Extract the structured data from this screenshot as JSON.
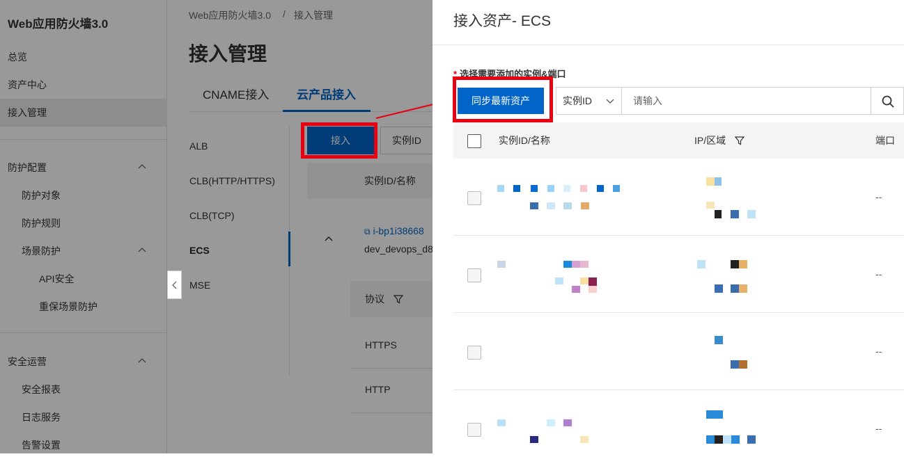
{
  "sidebar": {
    "app_title": "Web应用防火墙3.0",
    "items": [
      {
        "label": "总览"
      },
      {
        "label": "资产中心"
      },
      {
        "label": "接入管理",
        "active": true
      },
      {
        "label": "防护配置",
        "expandable": true
      },
      {
        "label": "防护对象"
      },
      {
        "label": "防护规则"
      },
      {
        "label": "场景防护",
        "expandable": true
      },
      {
        "label": "API安全"
      },
      {
        "label": "重保场景防护"
      },
      {
        "label": "安全运营",
        "expandable": true
      },
      {
        "label": "安全报表"
      },
      {
        "label": "日志服务"
      },
      {
        "label": "告警设置"
      }
    ]
  },
  "breadcrumb": {
    "root": "Web应用防火墙3.0",
    "separator": "/",
    "current": "接入管理"
  },
  "page": {
    "title": "接入管理",
    "tabs": [
      {
        "label": "CNAME接入"
      },
      {
        "label": "云产品接入",
        "active": true
      }
    ],
    "products": [
      {
        "label": "ALB"
      },
      {
        "label": "CLB(HTTP/HTTPS)"
      },
      {
        "label": "CLB(TCP)"
      },
      {
        "label": "ECS",
        "active": true
      },
      {
        "label": "MSE"
      }
    ],
    "join_button": "接入",
    "id_select": "实例ID",
    "table_header": "实例ID/名称",
    "instance_link": "i-bp1i38668",
    "instance_name": "dev_devops_d8",
    "sub_table_header": "协议",
    "protocols": [
      "HTTPS",
      "HTTP"
    ]
  },
  "drawer": {
    "title": "接入资产- ECS",
    "required_label": "选择需要添加的实例&端口",
    "sync_button": "同步最新资产",
    "search_field": "实例ID",
    "search_placeholder": "请输入",
    "columns": {
      "instance": "实例ID/名称",
      "ip_region": "IP/区域",
      "port": "端口"
    },
    "rows": [
      {
        "port": "--"
      },
      {
        "port": "--"
      },
      {
        "port": "--"
      },
      {
        "port": "--"
      }
    ]
  },
  "colors": {
    "primary": "#0064c8",
    "highlight": "#e60012"
  }
}
